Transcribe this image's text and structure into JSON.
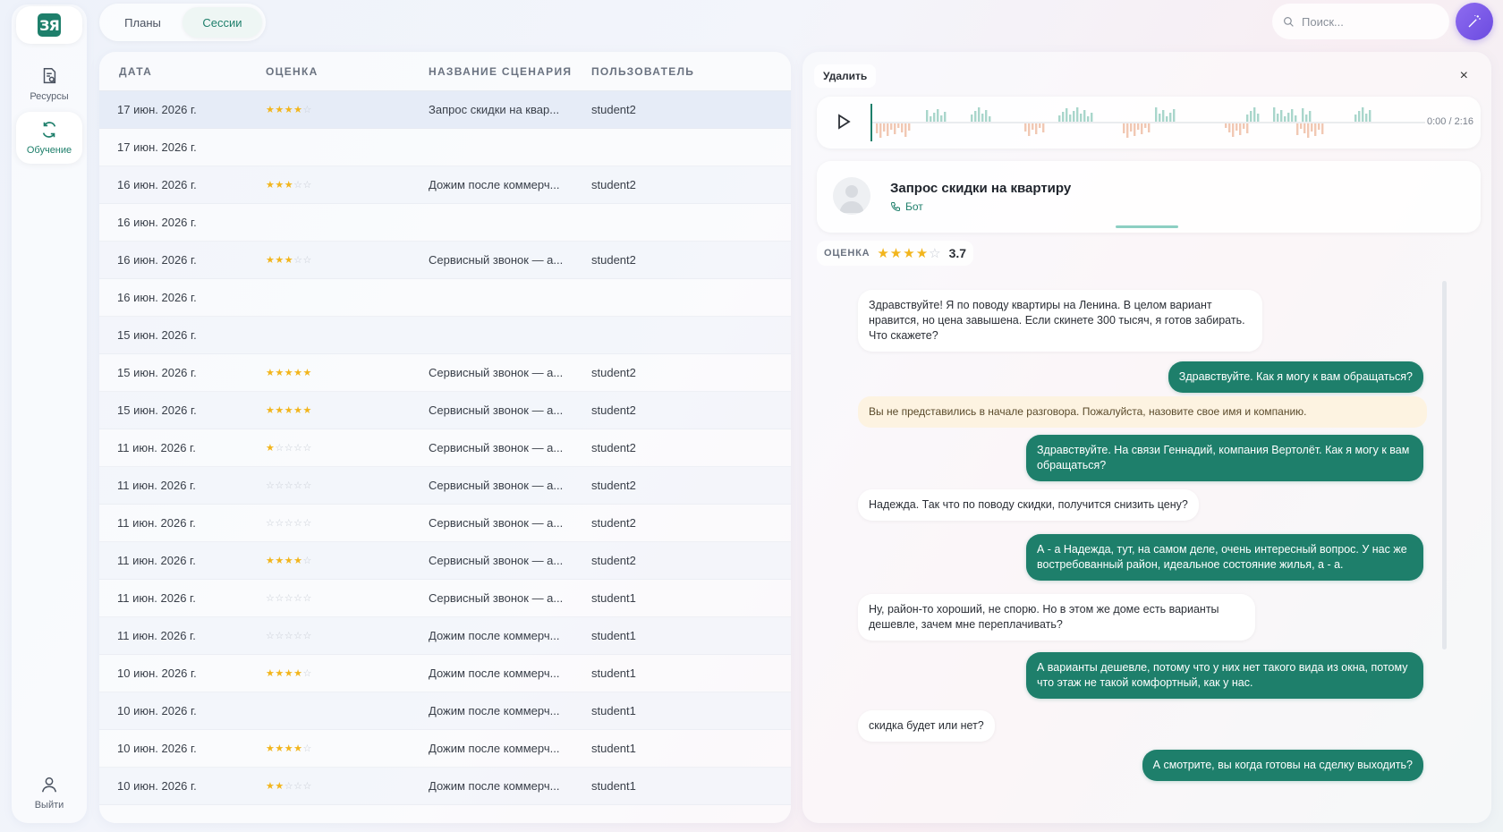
{
  "sidebar": {
    "logo_text": "ЗЯ",
    "items": [
      {
        "label": "Ресурсы",
        "icon": "document-search-icon"
      },
      {
        "label": "Обучение",
        "icon": "refresh-icon"
      }
    ],
    "logout_label": "Выйти"
  },
  "tabs": [
    {
      "label": "Планы"
    },
    {
      "label": "Сессии"
    }
  ],
  "search": {
    "placeholder": "Поиск..."
  },
  "table": {
    "headers": {
      "date": "ДАТА",
      "rating": "ОЦЕНКА",
      "name": "НАЗВАНИЕ СЦЕНАРИЯ",
      "user": "ПОЛЬЗОВАТЕЛЬ"
    },
    "rows": [
      {
        "date": "17 июн. 2026 г.",
        "stars": 4,
        "name": "Запрос скидки на квар...",
        "user": "student2"
      },
      {
        "date": "17 июн. 2026 г.",
        "stars": null,
        "name": "",
        "user": ""
      },
      {
        "date": "16 июн. 2026 г.",
        "stars": 3,
        "name": "Дожим после коммерч...",
        "user": "student2"
      },
      {
        "date": "16 июн. 2026 г.",
        "stars": null,
        "name": "",
        "user": ""
      },
      {
        "date": "16 июн. 2026 г.",
        "stars": 3,
        "name": "Сервисный звонок — а...",
        "user": "student2"
      },
      {
        "date": "16 июн. 2026 г.",
        "stars": null,
        "name": "",
        "user": ""
      },
      {
        "date": "15 июн. 2026 г.",
        "stars": null,
        "name": "",
        "user": ""
      },
      {
        "date": "15 июн. 2026 г.",
        "stars": 5,
        "name": "Сервисный звонок — а...",
        "user": "student2"
      },
      {
        "date": "15 июн. 2026 г.",
        "stars": 5,
        "name": "Сервисный звонок — а...",
        "user": "student2"
      },
      {
        "date": "11 июн. 2026 г.",
        "stars": 1,
        "name": "Сервисный звонок — а...",
        "user": "student2"
      },
      {
        "date": "11 июн. 2026 г.",
        "stars": 0,
        "name": "Сервисный звонок — а...",
        "user": "student2"
      },
      {
        "date": "11 июн. 2026 г.",
        "stars": 0,
        "name": "Сервисный звонок — а...",
        "user": "student2"
      },
      {
        "date": "11 июн. 2026 г.",
        "stars": 4,
        "name": "Сервисный звонок — а...",
        "user": "student2"
      },
      {
        "date": "11 июн. 2026 г.",
        "stars": 0,
        "name": "Сервисный звонок — а...",
        "user": "student1"
      },
      {
        "date": "11 июн. 2026 г.",
        "stars": 0,
        "name": "Дожим после коммерч...",
        "user": "student1"
      },
      {
        "date": "10 июн. 2026 г.",
        "stars": 4,
        "name": "Дожим после коммерч...",
        "user": "student1"
      },
      {
        "date": "10 июн. 2026 г.",
        "stars": null,
        "name": "Дожим после коммерч...",
        "user": "student1"
      },
      {
        "date": "10 июн. 2026 г.",
        "stars": 4,
        "name": "Дожим после коммерч...",
        "user": "student1"
      },
      {
        "date": "10 июн. 2026 г.",
        "stars": 2,
        "name": "Дожим после коммерч...",
        "user": "student1"
      }
    ]
  },
  "detail": {
    "delete_label": "Удалить",
    "close_label": "×",
    "player_time": "0:00 / 2:16",
    "scenario_title": "Запрос скидки на квартиру",
    "scenario_sub": "Бот",
    "rating_label": "ОЦЕНКА",
    "rating_stars": 4,
    "rating_value": "3.7",
    "messages": [
      {
        "role": "bot",
        "text": "Здравствуйте! Я по поводу квартиры на Ленина. В целом вариант нравится, но цена завышена. Если скинете 300 тысяч, я готов забирать. Что скажете?"
      },
      {
        "role": "user",
        "text": "Здравствуйте. Как я могу к вам обращаться?"
      },
      {
        "role": "warn",
        "text": "Вы не представились в начале разговора. Пожалуйста, назовите свое имя и компанию."
      },
      {
        "role": "user",
        "text": "Здравствуйте. На связи Геннадий, компания Вертолёт. Как я могу к вам обращаться?"
      },
      {
        "role": "bot",
        "text": "Надежда. Так что по поводу скидки, получится снизить цену?"
      },
      {
        "role": "user",
        "text": "А - а Надежда, тут, на самом деле, очень интересный вопрос. У нас же востребованный район, идеальное состояние жилья, а - а."
      },
      {
        "role": "bot",
        "text": "Ну, район-то хороший, не спорю. Но в этом же доме есть варианты дешевле, зачем мне переплачивать?"
      },
      {
        "role": "user",
        "text": "А варианты дешевле, потому что у них нет такого вида из окна, потому что этаж не такой комфортный, как у нас."
      },
      {
        "role": "bot",
        "text": "скидка будет или нет?"
      },
      {
        "role": "user",
        "text": "А смотрите, вы когда готовы на сделку выходить?"
      }
    ]
  },
  "colors": {
    "accent": "#1e7f6b",
    "star": "#f2b51c",
    "magic": "#7a5be8",
    "warn_bg": "#fdf3e1"
  }
}
